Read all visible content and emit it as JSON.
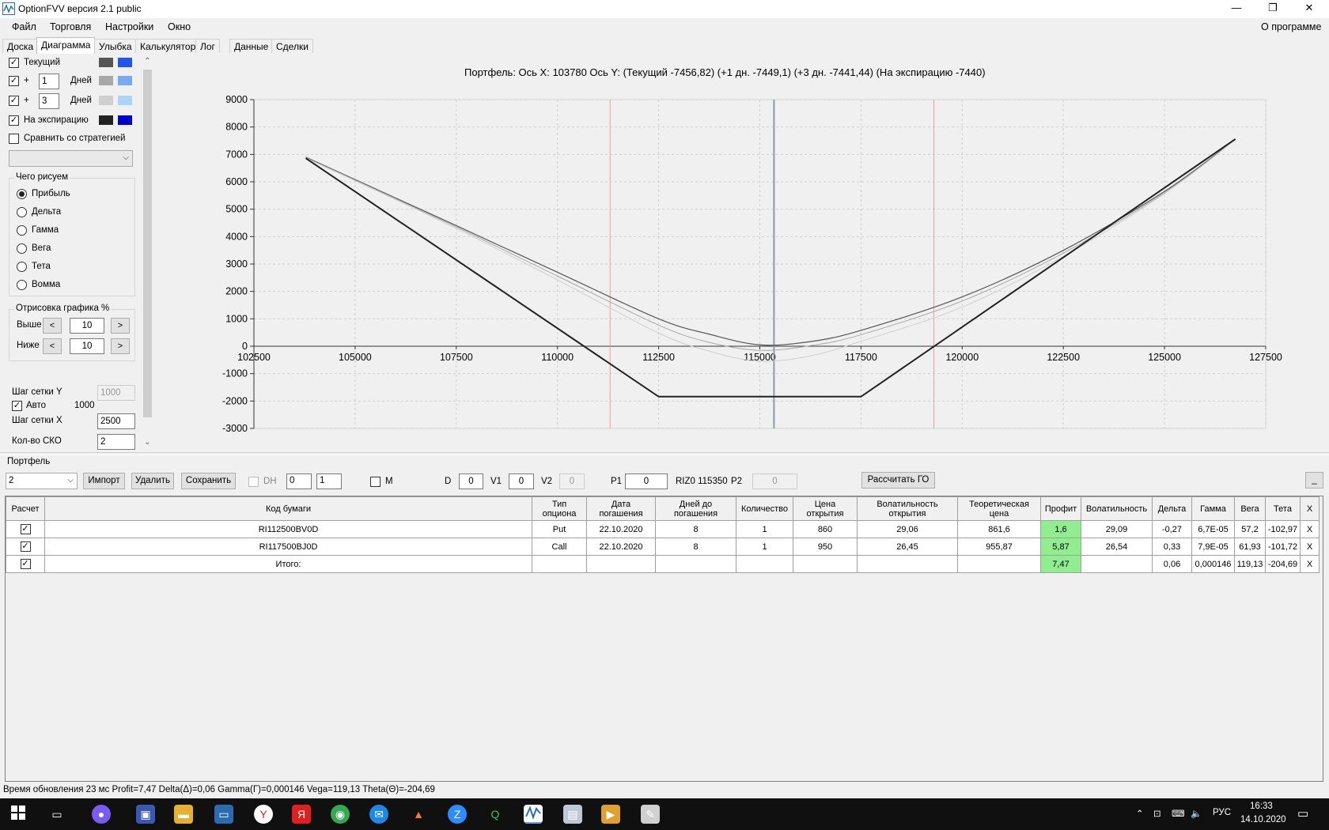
{
  "window": {
    "title": "OptionFVV версия 2.1 public",
    "minimize": "—",
    "restore": "❐",
    "close": "✕"
  },
  "menu": {
    "items": [
      "Файл",
      "Торговля",
      "Настройки",
      "Окно"
    ],
    "about": "О программе"
  },
  "tabs": [
    "Доска",
    "Диаграмма",
    "Улыбка",
    "Калькулятор",
    "Лог",
    "Данные",
    "Сделки"
  ],
  "active_tab": "Диаграмма",
  "left_panel": {
    "rows": [
      {
        "label": "Текущий",
        "checked": true,
        "color_dark": "#555555",
        "color_light": "#2255ee"
      },
      {
        "prefix": "+",
        "days": "1",
        "label": "Дней",
        "checked": true,
        "color_dark": "#a8a8a8",
        "color_light": "#77aaf0"
      },
      {
        "prefix": "+",
        "days": "3",
        "label": "Дней",
        "checked": true,
        "color_dark": "#cfcfcf",
        "color_light": "#aad4f8"
      },
      {
        "label": "На экспирацию",
        "checked": true,
        "color_dark": "#222222",
        "color_light": "#0000cc"
      }
    ],
    "compare_label": "Сравнить со стратегией",
    "compare_checked": false,
    "draw_group_title": "Чего рисуем",
    "draw_options": [
      "Прибыль",
      "Дельта",
      "Гамма",
      "Вега",
      "Тета",
      "Вомма"
    ],
    "draw_selected": "Прибыль",
    "render_group_title": "Отрисовка графика %",
    "above_label": "Выше",
    "above_value": "10",
    "below_label": "Ниже",
    "below_value": "10",
    "dec": "<",
    "inc": ">",
    "grid_y_label": "Шаг сетки Y",
    "grid_y_value": "1000",
    "auto_label": "Авто",
    "auto_checked": true,
    "auto_value": "1000",
    "grid_x_label": "Шаг сетки X",
    "grid_x_value": "2500",
    "sko_label": "Кол-во СКО",
    "sko_value": "2"
  },
  "chart_data": {
    "type": "line",
    "title": "Портфель: Ось X: 103780 Ось Y:  (Текущий -7456,82)  (+1 дн. -7449,1)  (+3 дн. -7441,44)  (На экспирацию -7440)",
    "xlim": [
      102500,
      127500
    ],
    "ylim": [
      -3000,
      9000
    ],
    "x_ticks": [
      "102500",
      "105000",
      "107500",
      "110000",
      "112500",
      "115000",
      "117500",
      "120000",
      "122500",
      "125000",
      "127500"
    ],
    "y_ticks": [
      "9000",
      "8000",
      "7000",
      "6000",
      "5000",
      "4000",
      "3000",
      "2000",
      "1000",
      "0",
      "-1000",
      "-2000",
      "-3000"
    ],
    "grid": true,
    "vertical_lines": [
      {
        "x": 111300,
        "color": "#f0a0a0"
      },
      {
        "x": 115350,
        "color": "#8a9ab0"
      },
      {
        "x": 119300,
        "color": "#f0a0a0"
      }
    ],
    "series": [
      {
        "x": [
          103780,
          105000,
          107500,
          110000,
          112500,
          113750,
          115000,
          116250,
          117500,
          120000,
          122500,
          125000,
          126750
        ],
        "y": [
          6900,
          6080,
          4400,
          2700,
          1000,
          440,
          50,
          170,
          580,
          1800,
          3500,
          5650,
          7550
        ],
        "color": "#555555",
        "width": 1.2
      },
      {
        "x": [
          103780,
          105000,
          107500,
          110000,
          112500,
          113750,
          115000,
          116250,
          117500,
          120000,
          122500,
          125000,
          126750
        ],
        "y": [
          6880,
          6060,
          4350,
          2560,
          770,
          140,
          -150,
          20,
          420,
          1650,
          3400,
          5600,
          7540
        ],
        "color": "#a8a8a8",
        "width": 1.0
      },
      {
        "x": [
          103780,
          105000,
          107500,
          110000,
          112500,
          113750,
          115000,
          116250,
          117500,
          120000,
          122500,
          125000,
          126750
        ],
        "y": [
          6860,
          6040,
          4300,
          2420,
          480,
          -180,
          -550,
          -350,
          180,
          1430,
          3280,
          5570,
          7530
        ],
        "color": "#cfcfcf",
        "width": 1.0
      },
      {
        "x": [
          103780,
          112500,
          117500,
          126750
        ],
        "y": [
          6860,
          -1840,
          -1840,
          7560
        ],
        "color": "#222222",
        "width": 2.0
      }
    ]
  },
  "portfolio": {
    "label": "Портфель",
    "selected": "2",
    "import": "Импорт",
    "delete": "Удалить",
    "save": "Сохранить",
    "dh_label": "DH",
    "spin1": "0",
    "spin2": "1",
    "m_label": "M",
    "d_label": "D",
    "d_value": "0",
    "v1_label": "V1",
    "v1_value": "0",
    "v2_label": "V2",
    "v2_value": "0",
    "p1_label": "P1",
    "p1_value": "0",
    "riz_label": "RIZ0 115350",
    "p2_label": "P2",
    "p2_value": "0",
    "calc_go": "Рассчитать ГО",
    "minimize": "_"
  },
  "table": {
    "headers": [
      "Расчет",
      "Код бумаги",
      "Тип опциона",
      "Дата погашения",
      "Дней до погашения",
      "Количество",
      "Цена открытия",
      "Волатильность открытия",
      "Теоретическая цена",
      "Профит",
      "Волатильность",
      "Дельта",
      "Гамма",
      "Вега",
      "Тета",
      "X"
    ],
    "rows": [
      {
        "code": "RI112500BV0D",
        "type": "Put",
        "date": "22.10.2020",
        "days": "8",
        "qty": "1",
        "price": "860",
        "vol_open": "29,06",
        "theo": "861,6",
        "profit": "1,6",
        "vol": "29,09",
        "delta": "-0,27",
        "gamma": "6,7E-05",
        "vega": "57,2",
        "theta": "-102,97",
        "x": "X"
      },
      {
        "code": "RI117500BJ0D",
        "type": "Call",
        "date": "22.10.2020",
        "days": "8",
        "qty": "1",
        "price": "950",
        "vol_open": "26,45",
        "theo": "955,87",
        "profit": "5,87",
        "vol": "26,54",
        "delta": "0,33",
        "gamma": "7,9E-05",
        "vega": "61,93",
        "theta": "-101,72",
        "x": "X"
      },
      {
        "code": "Итого:",
        "type": "",
        "date": "",
        "days": "",
        "qty": "",
        "price": "",
        "vol_open": "",
        "theo": "",
        "profit": "7,47",
        "vol": "",
        "delta": "0,06",
        "gamma": "0,000146",
        "vega": "119,13",
        "theta": "-204,69",
        "x": "X"
      }
    ]
  },
  "status": "Время обновления 23 мс  Profit=7,47 Delta(Δ)=0,06 Gamma(Γ)=0,000146 Vega=119,13 Theta(Θ)=-204,69",
  "taskbar": {
    "lang": "РУС",
    "time": "16:33",
    "date": "14.10.2020"
  }
}
